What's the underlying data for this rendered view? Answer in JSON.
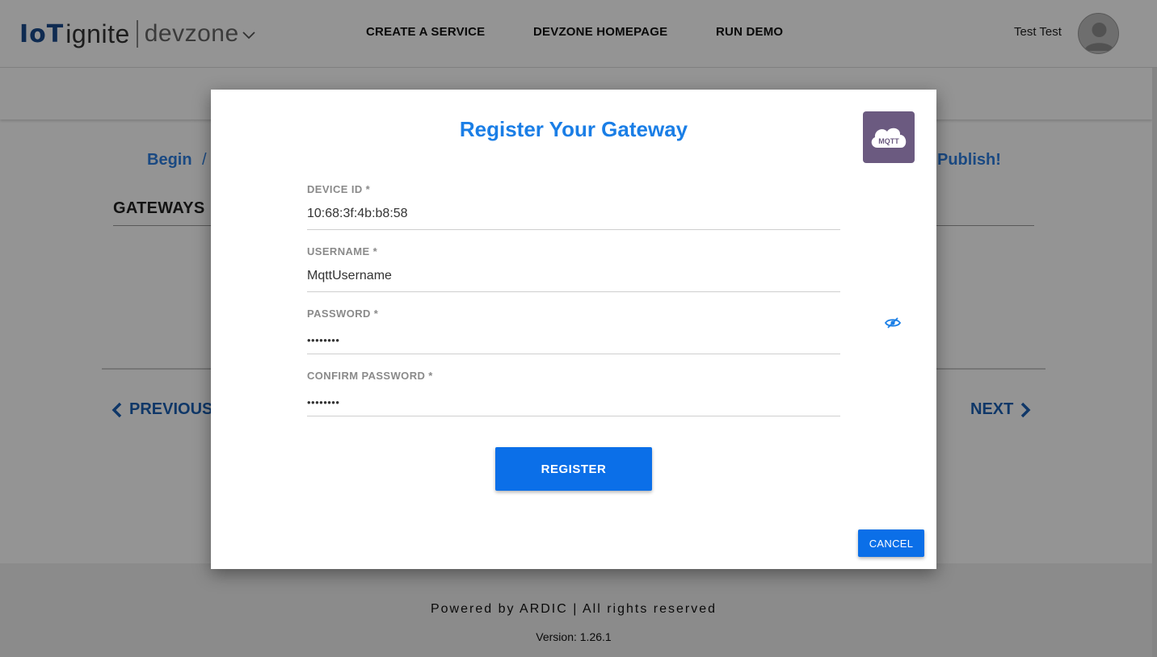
{
  "header": {
    "logo_iot": "IoT",
    "logo_ignite": "ignite",
    "logo_devzone": "devzone",
    "nav": [
      {
        "label": "CREATE A SERVICE"
      },
      {
        "label": "DEVZONE HOMEPAGE"
      },
      {
        "label": "RUN DEMO"
      }
    ],
    "user_name": "Test Test"
  },
  "page": {
    "breadcrumb_begin": "Begin",
    "breadcrumb_sep": "/",
    "breadcrumb_publish": "Publish!",
    "section_title": "GATEWAYS",
    "previous_label": "PREVIOUS",
    "next_label": "NEXT"
  },
  "footer": {
    "powered": "Powered by ARDIC | All rights reserved",
    "version": "Version: 1.26.1"
  },
  "modal": {
    "title": "Register Your Gateway",
    "badge_text": "MQTT",
    "fields": [
      {
        "label": "DEVICE ID *",
        "value": "10:68:3f:4b:b8:58"
      },
      {
        "label": "USERNAME *",
        "value": "MqttUsername"
      },
      {
        "label": "PASSWORD *",
        "value": "••••••••"
      },
      {
        "label": "CONFIRM PASSWORD *",
        "value": "••••••••"
      }
    ],
    "register_label": "REGISTER",
    "cancel_label": "CANCEL"
  },
  "colors": {
    "accent": "#0b6fe8",
    "title": "#1a7ee6",
    "badge": "#6b5a80"
  }
}
